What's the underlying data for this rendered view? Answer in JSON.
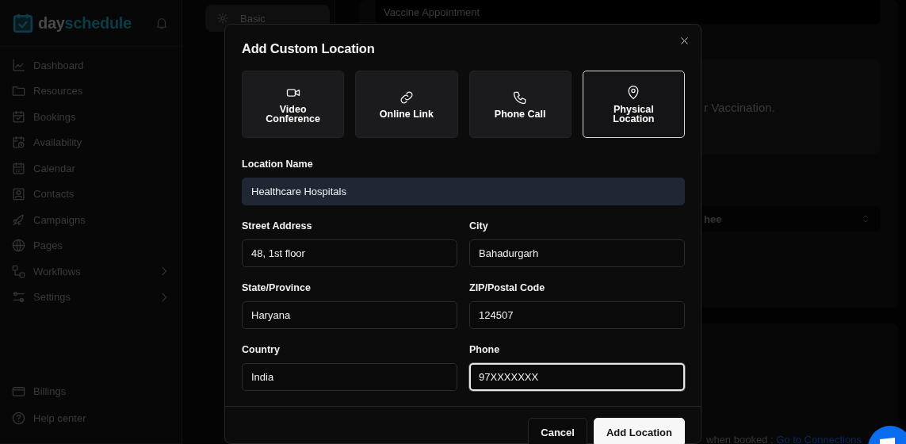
{
  "sidebar": {
    "logo": {
      "prefix": "day",
      "suffix": "schedule"
    },
    "nav_items": [
      {
        "label": "Dashboard",
        "has_submenu": false
      },
      {
        "label": "Resources",
        "has_submenu": false
      },
      {
        "label": "Bookings",
        "has_submenu": false
      },
      {
        "label": "Availability",
        "has_submenu": false
      },
      {
        "label": "Calendar",
        "has_submenu": false
      },
      {
        "label": "Contacts",
        "has_submenu": false
      },
      {
        "label": "Campaigns",
        "has_submenu": false
      },
      {
        "label": "Pages",
        "has_submenu": false
      },
      {
        "label": "Workflows",
        "has_submenu": true
      },
      {
        "label": "Settings",
        "has_submenu": true
      }
    ],
    "footer_items": [
      {
        "label": "Billings"
      },
      {
        "label": "Help center"
      }
    ]
  },
  "settings_nav": {
    "items": [
      {
        "label": "Basic",
        "selected": true
      }
    ]
  },
  "background": {
    "title_field": "Vaccine Appointment",
    "description": "r Vaccination.",
    "select_value": "hee",
    "connections_note": "when booked :",
    "connections_link": "Go to Connections"
  },
  "modal": {
    "title": "Add Custom Location",
    "location_types": [
      {
        "label": "Video Conference",
        "selected": false
      },
      {
        "label": "Online Link",
        "selected": false
      },
      {
        "label": "Phone Call",
        "selected": false
      },
      {
        "label": "Physical Location",
        "selected": true
      }
    ],
    "location_name": {
      "label": "Location Name",
      "value": "Healthcare Hospitals"
    },
    "fields": [
      {
        "label": "Street Address",
        "value": "48, 1st floor",
        "focused": false
      },
      {
        "label": "City",
        "value": "Bahadurgarh",
        "focused": false
      },
      {
        "label": "State/Province",
        "value": "Haryana",
        "focused": false
      },
      {
        "label": "ZIP/Postal Code",
        "value": "124507",
        "focused": false
      },
      {
        "label": "Country",
        "value": "India",
        "focused": false
      },
      {
        "label": "Phone",
        "value": "97XXXXXXX",
        "focused": true
      }
    ],
    "buttons": [
      {
        "label": "Cancel",
        "kind": "secondary"
      },
      {
        "label": "Add Location",
        "kind": "primary"
      }
    ]
  }
}
